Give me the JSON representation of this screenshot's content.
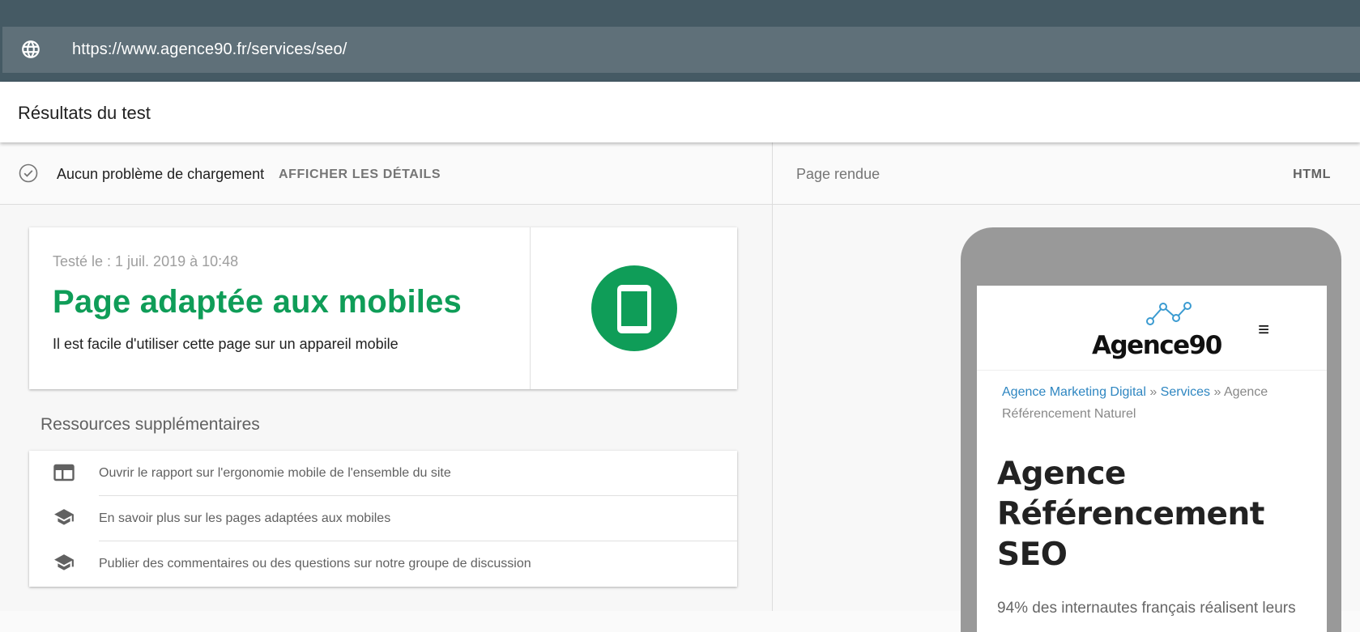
{
  "url_bar": {
    "url": "https://www.agence90.fr/services/seo/"
  },
  "header": {
    "title": "Résultats du test"
  },
  "status": {
    "text": "Aucun problème de chargement",
    "details_label": "AFFICHER LES DÉTAILS"
  },
  "result": {
    "date": "Testé le : 1 juil. 2019 à 10:48",
    "headline": "Page adaptée aux mobiles",
    "subtitle": "Il est facile d'utiliser cette page sur un appareil mobile",
    "accent_color": "#0f9d58"
  },
  "resources": {
    "title": "Ressources supplémentaires",
    "items": [
      {
        "icon": "web-layout-icon",
        "label": "Ouvrir le rapport sur l'ergonomie mobile de l'ensemble du site"
      },
      {
        "icon": "school-icon",
        "label": "En savoir plus sur les pages adaptées aux mobiles"
      },
      {
        "icon": "school-icon",
        "label": "Publier des commentaires ou des questions sur notre groupe de discussion"
      }
    ]
  },
  "right_panel": {
    "title": "Page rendue",
    "html_tab": "HTML"
  },
  "rendered_page": {
    "logo_text": "Agence90",
    "menu_icon": "≡",
    "breadcrumb": {
      "link1": "Agence Marketing Digital",
      "sep1": " » ",
      "link2": "Services",
      "sep2": " » ",
      "current": "Agence Référencement Naturel"
    },
    "heading": "Agence Référencement SEO",
    "paragraph": "94% des internautes français réalisent leurs"
  }
}
